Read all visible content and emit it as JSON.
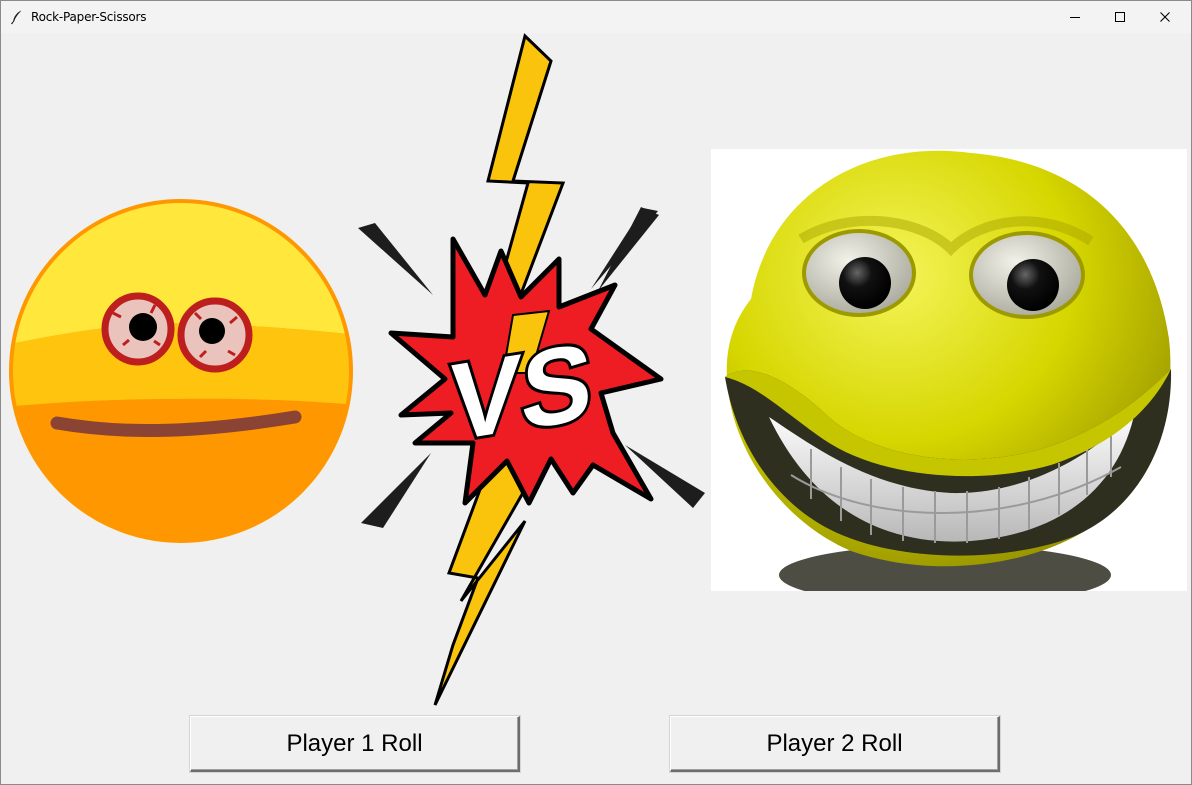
{
  "window": {
    "title": "Rock-Paper-Scissors",
    "controls": [
      "minimize",
      "maximize",
      "close"
    ]
  },
  "icons": {
    "app": "feather-icon",
    "minimize": "minimize-icon",
    "maximize": "maximize-icon",
    "close": "close-icon"
  },
  "images": {
    "player1": "hand-drawn-smiley-face",
    "center": "vs-lightning-burst",
    "player2": "3d-grinning-smiley-face"
  },
  "vs": {
    "text": "VS"
  },
  "buttons": {
    "player1_roll": "Player 1 Roll",
    "player2_roll": "Player 2 Roll"
  },
  "colors": {
    "window_bg": "#f0f0f0",
    "lightning": "#f7c10a",
    "burst": "#e8161e",
    "smiley_yellow": "#ffd21c",
    "smiley_orange": "#ff9a00",
    "grin_yellow": "#d6d600"
  }
}
